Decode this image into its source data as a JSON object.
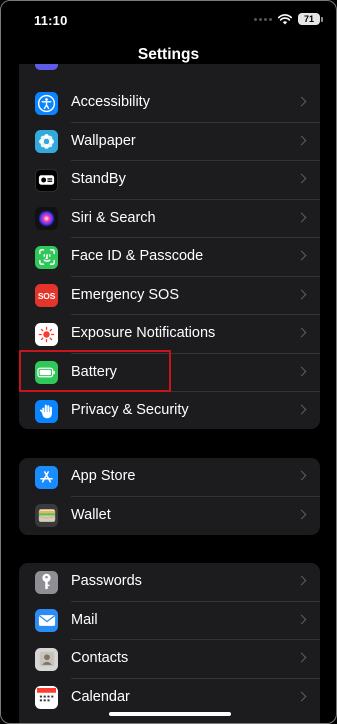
{
  "status_bar": {
    "time": "11:10",
    "battery_level": "71"
  },
  "nav": {
    "title": "Settings"
  },
  "groups": [
    {
      "items": [
        {
          "label": "Accessibility",
          "icon": "accessibility-icon",
          "color": "#0a84ff"
        },
        {
          "label": "Wallpaper",
          "icon": "wallpaper-icon",
          "color": "#34aadc"
        },
        {
          "label": "StandBy",
          "icon": "standby-icon",
          "color": "#000000"
        },
        {
          "label": "Siri & Search",
          "icon": "siri-icon",
          "color": "#1c1c1e"
        },
        {
          "label": "Face ID & Passcode",
          "icon": "face-id-icon",
          "color": "#30c85a"
        },
        {
          "label": "Emergency SOS",
          "icon": "sos-icon",
          "color": "#e5352b"
        },
        {
          "label": "Exposure Notifications",
          "icon": "exposure-icon",
          "color": "#ffffff"
        },
        {
          "label": "Battery",
          "icon": "battery-icon",
          "color": "#30c85a",
          "highlighted": true
        },
        {
          "label": "Privacy & Security",
          "icon": "hand-icon",
          "color": "#0a84ff"
        }
      ]
    },
    {
      "items": [
        {
          "label": "App Store",
          "icon": "app-store-icon",
          "color": "#1a8cff"
        },
        {
          "label": "Wallet",
          "icon": "wallet-icon",
          "color": "#3a3a3c"
        }
      ]
    },
    {
      "items": [
        {
          "label": "Passwords",
          "icon": "key-icon",
          "color": "#8e8e93"
        },
        {
          "label": "Mail",
          "icon": "mail-icon",
          "color": "#2b8cf5"
        },
        {
          "label": "Contacts",
          "icon": "contacts-icon",
          "color": "#d6d6d6"
        },
        {
          "label": "Calendar",
          "icon": "calendar-icon",
          "color": "#ffffff"
        }
      ]
    }
  ]
}
